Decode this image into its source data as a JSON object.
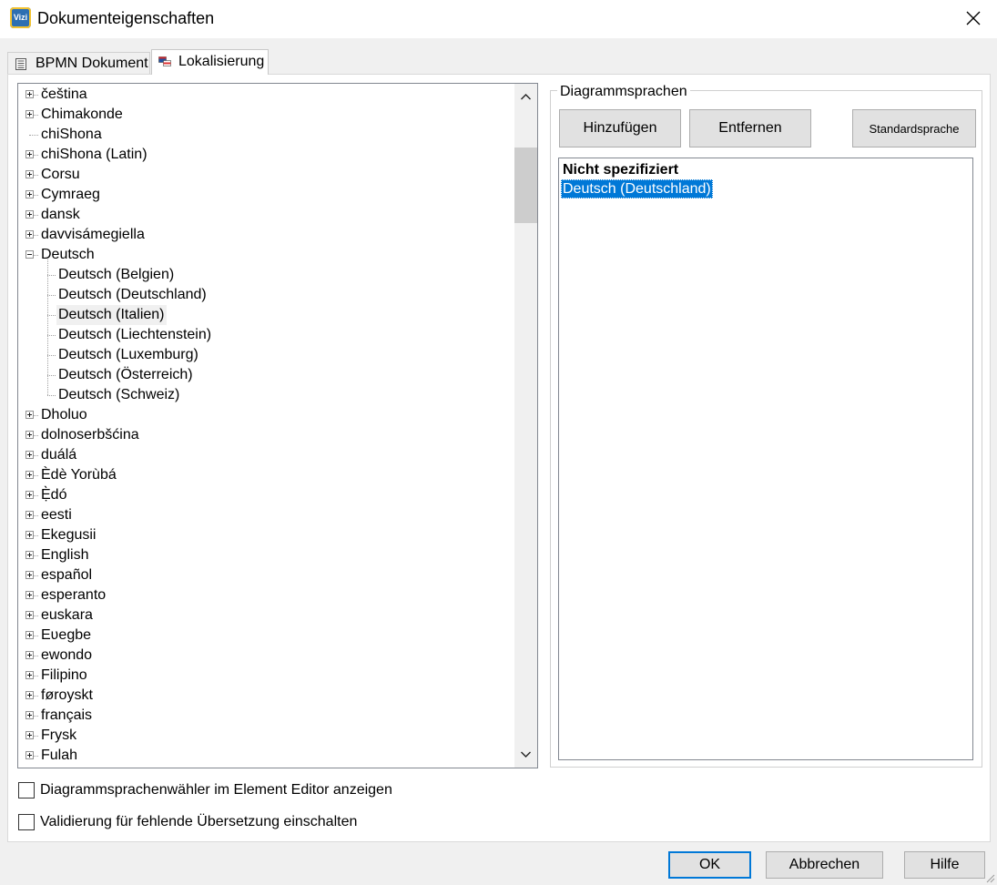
{
  "window": {
    "title": "Dokumenteigenschaften",
    "icon_text": "Vizi"
  },
  "tabs": [
    {
      "label": "BPMN Dokument",
      "icon": "document-list-icon",
      "active": false
    },
    {
      "label": "Lokalisierung",
      "icon": "flags-icon",
      "active": true
    }
  ],
  "tree": {
    "items": [
      {
        "label": "čeština",
        "expander": "plus",
        "level": 0
      },
      {
        "label": "Chimakonde",
        "expander": "plus",
        "level": 0
      },
      {
        "label": "chiShona",
        "expander": "none",
        "level": 0
      },
      {
        "label": "chiShona (Latin)",
        "expander": "plus",
        "level": 0
      },
      {
        "label": "Corsu",
        "expander": "plus",
        "level": 0
      },
      {
        "label": "Cymraeg",
        "expander": "plus",
        "level": 0
      },
      {
        "label": "dansk",
        "expander": "plus",
        "level": 0
      },
      {
        "label": "davvisámegiella",
        "expander": "plus",
        "level": 0
      },
      {
        "label": "Deutsch",
        "expander": "minus",
        "level": 0
      },
      {
        "label": "Deutsch (Belgien)",
        "expander": "none",
        "level": 1
      },
      {
        "label": "Deutsch (Deutschland)",
        "expander": "none",
        "level": 1
      },
      {
        "label": "Deutsch (Italien)",
        "expander": "none",
        "level": 1,
        "selected": true
      },
      {
        "label": "Deutsch (Liechtenstein)",
        "expander": "none",
        "level": 1
      },
      {
        "label": "Deutsch (Luxemburg)",
        "expander": "none",
        "level": 1
      },
      {
        "label": "Deutsch (Österreich)",
        "expander": "none",
        "level": 1
      },
      {
        "label": "Deutsch (Schweiz)",
        "expander": "none",
        "level": 1
      },
      {
        "label": "Dholuo",
        "expander": "plus",
        "level": 0
      },
      {
        "label": "dolnoserbšćina",
        "expander": "plus",
        "level": 0
      },
      {
        "label": "duálá",
        "expander": "plus",
        "level": 0
      },
      {
        "label": "Èdè Yorùbá",
        "expander": "plus",
        "level": 0
      },
      {
        "label": "Ẹ̀dó",
        "expander": "plus",
        "level": 0
      },
      {
        "label": "eesti",
        "expander": "plus",
        "level": 0
      },
      {
        "label": "Ekegusii",
        "expander": "plus",
        "level": 0
      },
      {
        "label": "English",
        "expander": "plus",
        "level": 0
      },
      {
        "label": "español",
        "expander": "plus",
        "level": 0
      },
      {
        "label": "esperanto",
        "expander": "plus",
        "level": 0
      },
      {
        "label": "euskara",
        "expander": "plus",
        "level": 0
      },
      {
        "label": "Eʋegbe",
        "expander": "plus",
        "level": 0
      },
      {
        "label": "ewondo",
        "expander": "plus",
        "level": 0
      },
      {
        "label": "Filipino",
        "expander": "plus",
        "level": 0
      },
      {
        "label": "føroyskt",
        "expander": "plus",
        "level": 0
      },
      {
        "label": "français",
        "expander": "plus",
        "level": 0
      },
      {
        "label": "Frysk",
        "expander": "plus",
        "level": 0
      },
      {
        "label": "Fulah",
        "expander": "plus",
        "level": 0
      }
    ]
  },
  "diagram_languages": {
    "group_title": "Diagrammsprachen",
    "add_label": "Hinzufügen",
    "remove_label": "Entfernen",
    "default_label": "Standardsprache",
    "items": [
      {
        "label": "Nicht spezifiziert",
        "bold": true
      },
      {
        "label": "Deutsch (Deutschland)",
        "selected": true
      }
    ]
  },
  "options": {
    "show_selector_label": "Diagrammsprachenwähler im Element Editor anzeigen",
    "show_selector_checked": false,
    "validation_label": "Validierung für fehlende Übersetzung einschalten",
    "validation_checked": false
  },
  "footer": {
    "ok_label": "OK",
    "cancel_label": "Abbrechen",
    "help_label": "Hilfe"
  },
  "colors": {
    "selection": "#0078d7",
    "accent": "#0078d7"
  }
}
